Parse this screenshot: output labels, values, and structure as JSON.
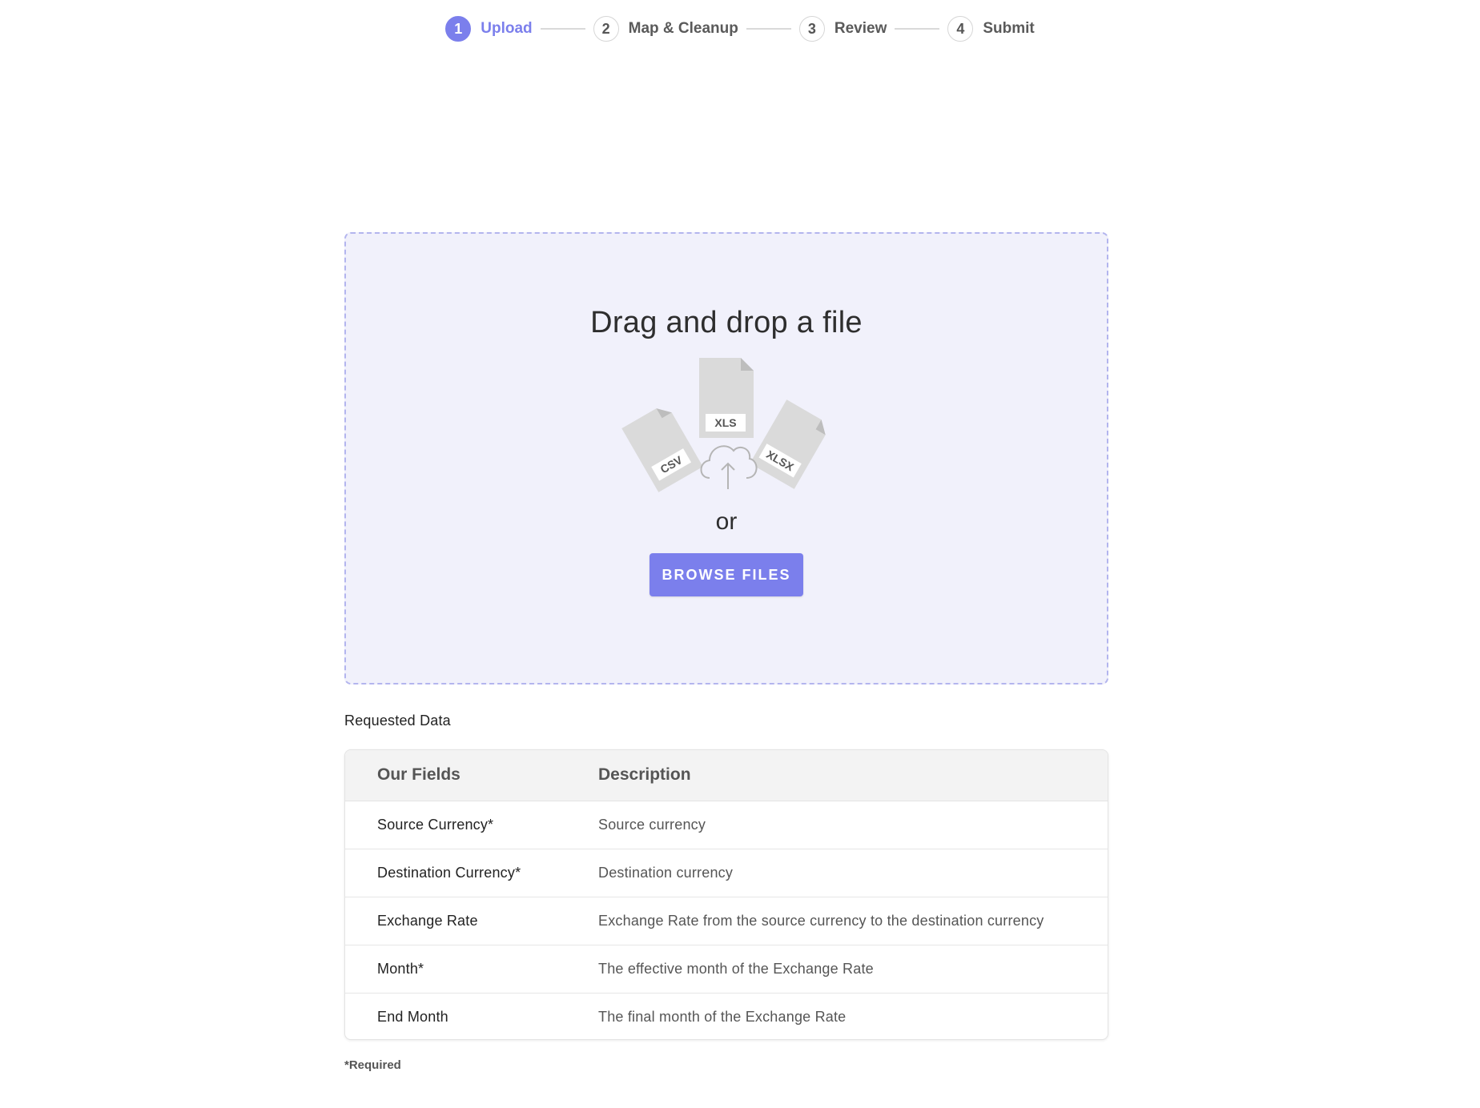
{
  "stepper": {
    "steps": [
      {
        "number": "1",
        "label": "Upload",
        "active": true
      },
      {
        "number": "2",
        "label": "Map & Cleanup",
        "active": false
      },
      {
        "number": "3",
        "label": "Review",
        "active": false
      },
      {
        "number": "4",
        "label": "Submit",
        "active": false
      }
    ]
  },
  "dropzone": {
    "title": "Drag and drop a file",
    "file_types": [
      "CSV",
      "XLS",
      "XLSX"
    ],
    "or_text": "or",
    "browse_label": "BROWSE FILES"
  },
  "requested_data": {
    "title": "Requested Data",
    "columns": [
      "Our Fields",
      "Description"
    ],
    "rows": [
      {
        "field": "Source Currency*",
        "description": "Source currency"
      },
      {
        "field": "Destination Currency*",
        "description": "Destination currency"
      },
      {
        "field": "Exchange Rate",
        "description": "Exchange Rate from the source currency to the destination currency"
      },
      {
        "field": "Month*",
        "description": "The effective month of the Exchange Rate"
      },
      {
        "field": "End Month",
        "description": "The final month of the Exchange Rate"
      }
    ],
    "required_note": "*Required"
  },
  "colors": {
    "accent": "#7b7fec",
    "dropzone_bg": "#f1f1fb",
    "dropzone_border": "#b3b5ee"
  }
}
